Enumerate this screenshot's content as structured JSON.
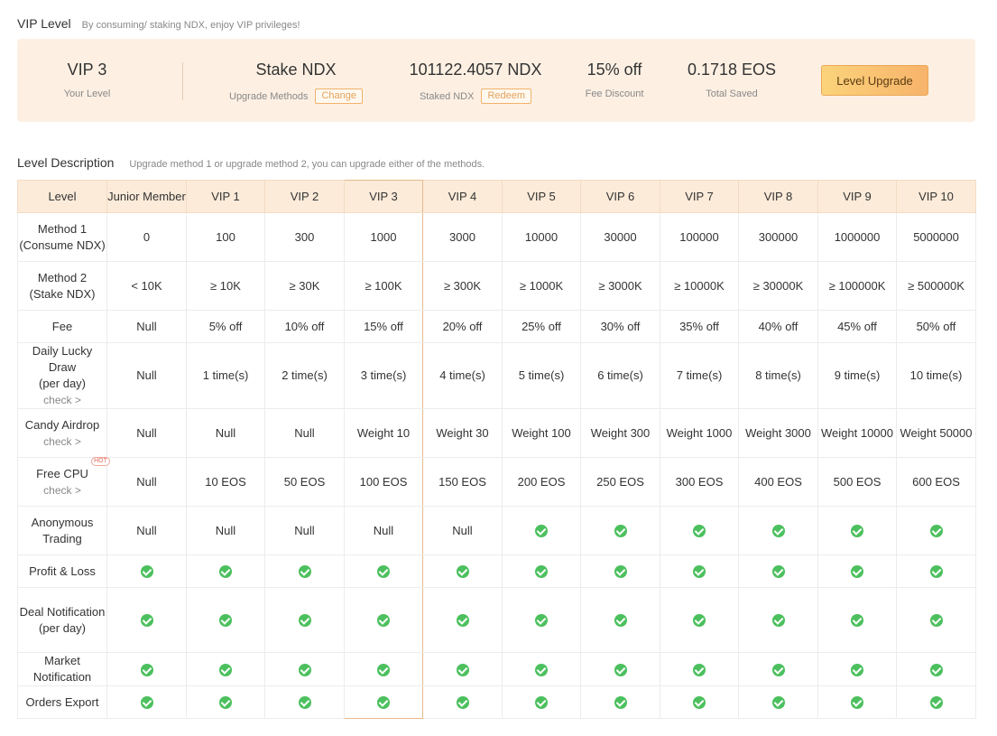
{
  "vip_section": {
    "title": "VIP Level",
    "subtitle": "By consuming/ staking NDX, enjoy VIP privileges!"
  },
  "summary": {
    "level": {
      "value": "VIP 3",
      "label": "Your Level"
    },
    "method": {
      "value": "Stake NDX",
      "label": "Upgrade Methods",
      "button": "Change"
    },
    "staked": {
      "value": "101122.4057 NDX",
      "label": "Staked NDX",
      "button": "Redeem"
    },
    "discount": {
      "value": "15% off",
      "label": "Fee Discount"
    },
    "saved": {
      "value": "0.1718 EOS",
      "label": "Total Saved"
    },
    "upgrade_button": "Level Upgrade"
  },
  "level_section": {
    "title": "Level Description",
    "subtitle": "Upgrade method 1 or upgrade method 2, you can upgrade either of the methods."
  },
  "table": {
    "corner": "Level",
    "columns": [
      "Junior Member",
      "VIP 1",
      "VIP 2",
      "VIP 3",
      "VIP 4",
      "VIP 5",
      "VIP 6",
      "VIP 7",
      "VIP 8",
      "VIP 9",
      "VIP 10"
    ],
    "highlight_column": 3,
    "check_link": "check >",
    "hot_badge": "HOT",
    "rows": [
      {
        "label": [
          "Method 1",
          "(Consume NDX)"
        ],
        "height": 54,
        "cells": [
          "0",
          "100",
          "300",
          "1000",
          "3000",
          "10000",
          "30000",
          "100000",
          "300000",
          "1000000",
          "5000000"
        ]
      },
      {
        "label": [
          "Method 2",
          "(Stake NDX)"
        ],
        "height": 54,
        "cells": [
          "< 10K",
          "≥ 10K",
          "≥ 30K",
          "≥ 100K",
          "≥ 300K",
          "≥ 1000K",
          "≥ 3000K",
          "≥ 10000K",
          "≥ 30000K",
          "≥ 100000K",
          "≥ 500000K"
        ]
      },
      {
        "label": [
          "Fee"
        ],
        "height": 36,
        "cells": [
          "Null",
          "5% off",
          "10% off",
          "15% off",
          "20% off",
          "25% off",
          "30% off",
          "35% off",
          "40% off",
          "45% off",
          "50% off"
        ]
      },
      {
        "label": [
          "Daily Lucky Draw",
          "(per day)"
        ],
        "check": true,
        "height": 72,
        "cells": [
          "Null",
          "1 time(s)",
          "2 time(s)",
          "3 time(s)",
          "4 time(s)",
          "5 time(s)",
          "6 time(s)",
          "7 time(s)",
          "8 time(s)",
          "9 time(s)",
          "10 time(s)"
        ]
      },
      {
        "label": [
          "Candy Airdrop"
        ],
        "check": true,
        "height": 54,
        "cells": [
          "Null",
          "Null",
          "Null",
          "Weight 10",
          "Weight 30",
          "Weight 100",
          "Weight 300",
          "Weight 1000",
          "Weight 3000",
          "Weight 10000",
          "Weight 50000"
        ]
      },
      {
        "label": [
          "Free CPU"
        ],
        "check": true,
        "hot": true,
        "height": 54,
        "cells": [
          "Null",
          "10 EOS",
          "50 EOS",
          "100 EOS",
          "150 EOS",
          "200 EOS",
          "250 EOS",
          "300 EOS",
          "400 EOS",
          "500 EOS",
          "600 EOS"
        ]
      },
      {
        "label": [
          "Anonymous",
          "Trading"
        ],
        "height": 54,
        "cells": [
          "Null",
          "Null",
          "Null",
          "Null",
          "Null",
          "✓",
          "✓",
          "✓",
          "✓",
          "✓",
          "✓"
        ]
      },
      {
        "label": [
          "Profit & Loss"
        ],
        "height": 36,
        "cells": [
          "✓",
          "✓",
          "✓",
          "✓",
          "✓",
          "✓",
          "✓",
          "✓",
          "✓",
          "✓",
          "✓"
        ]
      },
      {
        "label": [
          "Deal Notification",
          "(per day)"
        ],
        "height": 72,
        "cells": [
          "✓",
          "✓",
          "✓",
          "✓",
          "✓",
          "✓",
          "✓",
          "✓",
          "✓",
          "✓",
          "✓"
        ]
      },
      {
        "label": [
          "Market",
          "Notification"
        ],
        "height": 36,
        "cells": [
          "✓",
          "✓",
          "✓",
          "✓",
          "✓",
          "✓",
          "✓",
          "✓",
          "✓",
          "✓",
          "✓"
        ]
      },
      {
        "label": [
          "Orders Export"
        ],
        "height": 36,
        "cells": [
          "✓",
          "✓",
          "✓",
          "✓",
          "✓",
          "✓",
          "✓",
          "✓",
          "✓",
          "✓",
          "✓"
        ]
      }
    ]
  }
}
